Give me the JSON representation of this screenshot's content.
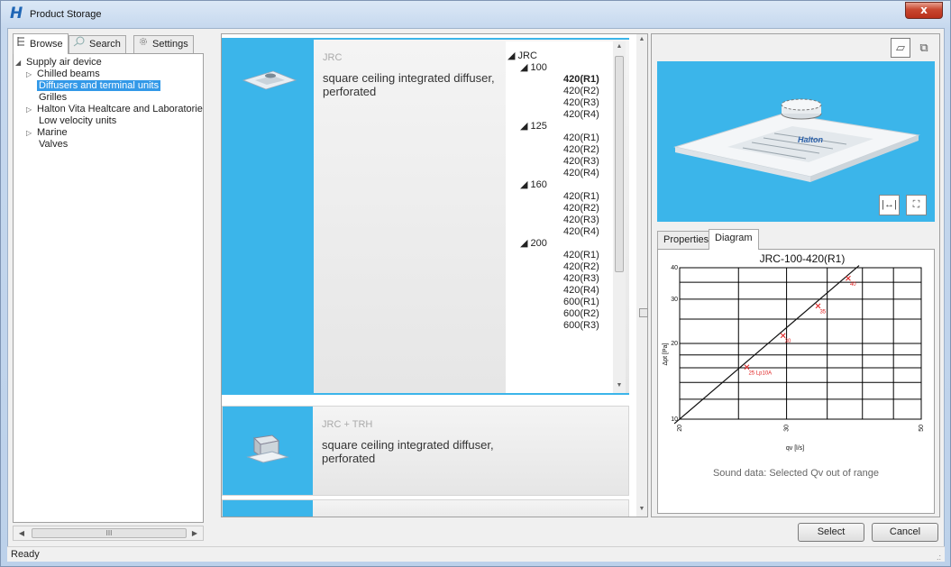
{
  "window": {
    "title": "Product Storage",
    "close_label": "x"
  },
  "left_tabs": [
    {
      "label": "Browse",
      "icon": "tree-list-icon"
    },
    {
      "label": "Search",
      "icon": "search-icon"
    },
    {
      "label": "Settings",
      "icon": "gear-icon"
    }
  ],
  "tree": {
    "root": "Supply air device",
    "items": [
      {
        "label": "Chilled beams",
        "expandable": true
      },
      {
        "label": "Diffusers and terminal units",
        "expandable": false,
        "selected": true
      },
      {
        "label": "Grilles",
        "expandable": false
      },
      {
        "label": "Halton Vita Healtcare and Laboratorie",
        "expandable": true
      },
      {
        "label": "Low velocity units",
        "expandable": false
      },
      {
        "label": "Marine",
        "expandable": true
      },
      {
        "label": "Valves",
        "expandable": false
      }
    ],
    "hscroll_grip": "III"
  },
  "products": [
    {
      "code": "JRC",
      "description": "square ceiling integrated diffuser, perforated"
    },
    {
      "code": "JRC + TRH",
      "description": "square ceiling integrated diffuser, perforated"
    }
  ],
  "size_tree": {
    "root": "JRC",
    "groups": [
      {
        "size": "100",
        "variants": [
          "420(R1)",
          "420(R2)",
          "420(R3)",
          "420(R4)"
        ],
        "selected": "420(R1)"
      },
      {
        "size": "125",
        "variants": [
          "420(R1)",
          "420(R2)",
          "420(R3)",
          "420(R4)"
        ]
      },
      {
        "size": "160",
        "variants": [
          "420(R1)",
          "420(R2)",
          "420(R3)",
          "420(R4)"
        ]
      },
      {
        "size": "200",
        "variants": [
          "420(R1)",
          "420(R2)",
          "420(R3)",
          "420(R4)",
          "600(R1)",
          "600(R2)",
          "600(R3)"
        ]
      }
    ]
  },
  "preview": {
    "brand": "Halton"
  },
  "right_tabs": [
    {
      "label": "Properties"
    },
    {
      "label": "Diagram",
      "active": true
    }
  ],
  "diagram_message": "Sound data: Selected Qv out of range",
  "buttons": {
    "select": "Select",
    "cancel": "Cancel"
  },
  "status": {
    "text": "Ready"
  },
  "chart_data": {
    "type": "line",
    "title": "JRC-100-420(R1)",
    "xlabel": "qv [l/s]",
    "ylabel": "Δpt [Pa]",
    "xscale": "log",
    "yscale": "log",
    "xlim": [
      20,
      50
    ],
    "ylim": [
      10,
      40
    ],
    "x_ticks": [
      "20",
      "30",
      "50"
    ],
    "y_ticks": [
      "10",
      "20",
      "30",
      "40"
    ],
    "grid": true,
    "series": [
      {
        "x": [
          19.6,
          39.5
        ],
        "y": [
          9.6,
          40.8
        ]
      }
    ],
    "annotations": [
      {
        "x": 25.8,
        "y": 16.1,
        "text": "25 Lp10A"
      },
      {
        "x": 29.6,
        "y": 21.5,
        "text": "30"
      },
      {
        "x": 33.8,
        "y": 28.2,
        "text": "35"
      },
      {
        "x": 37.9,
        "y": 36.3,
        "text": "40"
      }
    ],
    "colors": {
      "line": "#111111",
      "markers": "#e02020",
      "grid": "#000000"
    }
  }
}
